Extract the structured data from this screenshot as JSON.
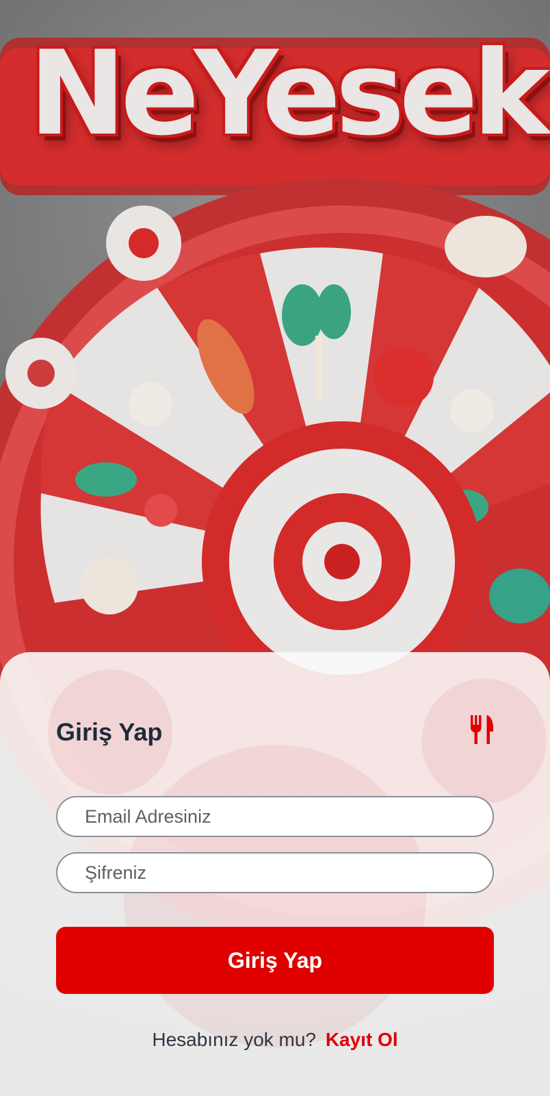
{
  "hero": {
    "logo_text": "NeYesek"
  },
  "login": {
    "title": "Giriş Yap",
    "icon": "utensils-icon",
    "email_placeholder": "Email Adresiniz",
    "password_placeholder": "Şifreniz",
    "submit_label": "Giriş Yap",
    "signup_prompt": "Hesabınız yok mu?",
    "signup_link": "Kayıt Ol"
  },
  "colors": {
    "accent": "#e00000",
    "title": "#1e2a3c",
    "input_border": "#8b8f98"
  }
}
